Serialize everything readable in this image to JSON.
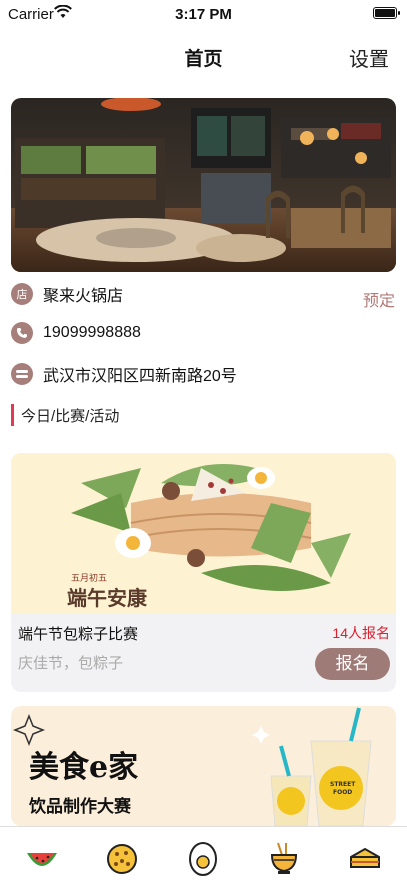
{
  "status_bar": {
    "carrier": "Carrier",
    "time": "3:17 PM"
  },
  "nav": {
    "title": "首页",
    "settings_label": "设置"
  },
  "store": {
    "name": "聚来火锅店",
    "phone": "19099998888",
    "address": "武汉市汉阳区四新南路20号",
    "reserve_label": "预定",
    "name_icon_text": "店"
  },
  "section": {
    "label": "今日/比赛/活动"
  },
  "events": [
    {
      "banner_text_small": "五月初五",
      "banner_text_big": "端午安康",
      "title": "端午节包粽子比赛",
      "count": "14人报名",
      "subtitle": "庆佳节，包粽子",
      "button": "报名"
    },
    {
      "title": "美食e家",
      "subtitle": "饮品制作大赛",
      "cup_text": "STREET FOOD"
    }
  ],
  "tab_bar": {
    "items": [
      {
        "icon": "watermelon-icon"
      },
      {
        "icon": "cookie-icon"
      },
      {
        "icon": "egg-icon"
      },
      {
        "icon": "noodle-bowl-icon"
      },
      {
        "icon": "cake-slice-icon"
      }
    ]
  },
  "colors": {
    "accent": "#9f7b78",
    "reserve": "#b07a76",
    "section_bar": "#e03a55",
    "count": "#d8202e"
  }
}
